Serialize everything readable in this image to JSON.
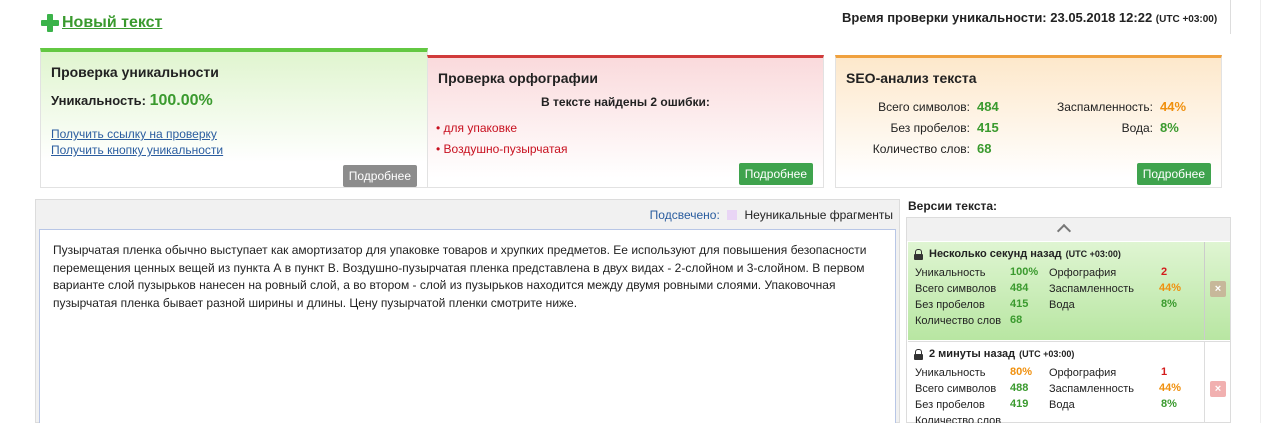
{
  "header": {
    "new_text": "Новый текст",
    "check_time_label": "Время проверки уникальности: 23.05.2018 12:22",
    "check_time_tz": "(UTC +03:00)"
  },
  "uniqueness": {
    "title": "Проверка уникальности",
    "label": "Уникальность:",
    "value": "100.00%",
    "link_check": "Получить ссылку на проверку",
    "link_button": "Получить кнопку уникальности",
    "details": "Подробнее",
    "accent": "#63c842"
  },
  "spelling": {
    "title": "Проверка орфографии",
    "found": "В тексте найдены 2 ошибки:",
    "errors": [
      "• для упаковке",
      "• Воздушно-пузырчатая"
    ],
    "details": "Подробнее",
    "accent": "#d13b3b"
  },
  "seo": {
    "title": "SEO-анализ текста",
    "total_label": "Всего символов:",
    "total_value": "484",
    "nospace_label": "Без пробелов:",
    "nospace_value": "415",
    "words_label": "Количество слов:",
    "words_value": "68",
    "spam_label": "Заспамленность:",
    "spam_value": "44%",
    "water_label": "Вода:",
    "water_value": "8%",
    "details": "Подробнее",
    "accent": "#f0a13e"
  },
  "editor": {
    "highlight_label": "Подсвечено:",
    "highlight_legend": "Неуникальные фрагменты",
    "text": "Пузырчатая пленка обычно выступает как амортизатор для упаковке товаров и хрупких предметов. Ее используют для повышения безопасности перемещения ценных вещей из пункта А в пункт В. Воздушно-пузырчатая пленка представлена в двух видах - 2-слойном и 3-слойном. В первом варианте слой пузырьков нанесен на ровный слой, а во втором - слой из пузырьков находится между двумя ровными слоями. Упаковочная пузырчатая пленка бывает разной ширины и длины. Цену пузырчатой пленки смотрите ниже."
  },
  "versions": {
    "title": "Версии текста:",
    "items": [
      {
        "time": "Несколько секунд назад",
        "tz": "(UTC +03:00)",
        "uniq_label": "Уникальность",
        "uniq": "100%",
        "total_label": "Всего символов",
        "total": "484",
        "nospace_label": "Без пробелов",
        "nospace": "415",
        "words_label": "Количество слов",
        "words": "68",
        "spell_label": "Орфография",
        "spell": "2",
        "spam_label": "Заспамленность",
        "spam": "44%",
        "water_label": "Вода",
        "water": "8%",
        "delete": "×"
      },
      {
        "time": "2 минуты назад",
        "tz": "(UTC +03:00)",
        "uniq_label": "Уникальность",
        "uniq": "80%",
        "total_label": "Всего символов",
        "total": "488",
        "nospace_label": "Без пробелов",
        "nospace": "419",
        "words_label": "Количество слов",
        "words": "",
        "spell_label": "Орфография",
        "spell": "1",
        "spam_label": "Заспамленность",
        "spam": "44%",
        "water_label": "Вода",
        "water": "8%",
        "delete": "×"
      }
    ]
  }
}
